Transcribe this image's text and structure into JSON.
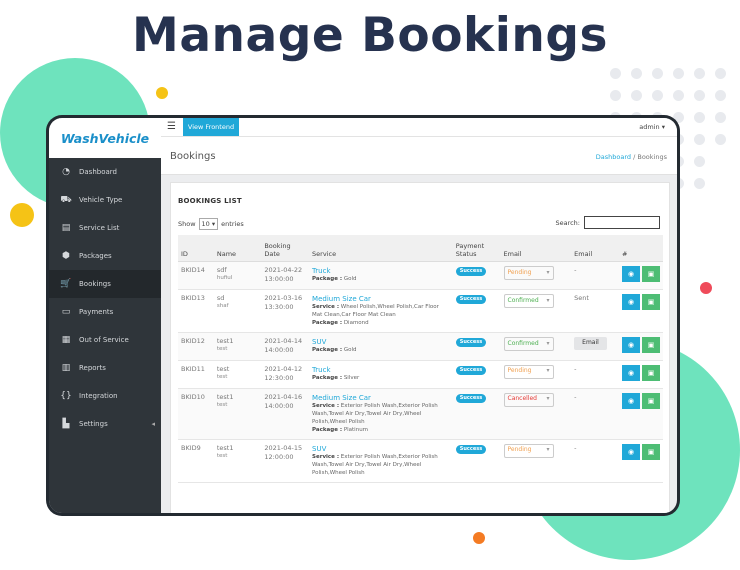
{
  "headline": "Manage Bookings",
  "brand": "WashVehicle",
  "topbar": {
    "view_frontend": "View Frontend",
    "admin": "admin ▾"
  },
  "sidebar": {
    "items": [
      {
        "label": "Dashboard",
        "icon": "dashboard-icon"
      },
      {
        "label": "Vehicle Type",
        "icon": "car-icon"
      },
      {
        "label": "Service List",
        "icon": "document-icon"
      },
      {
        "label": "Packages",
        "icon": "package-icon"
      },
      {
        "label": "Bookings",
        "icon": "cart-icon"
      },
      {
        "label": "Payments",
        "icon": "credit-card-icon"
      },
      {
        "label": "Out of Service",
        "icon": "calendar-icon"
      },
      {
        "label": "Reports",
        "icon": "report-icon"
      },
      {
        "label": "Integration",
        "icon": "braces-icon"
      },
      {
        "label": "Settings",
        "icon": "building-icon"
      }
    ]
  },
  "page": {
    "title": "Bookings",
    "breadcrumb_home": "Dashboard",
    "breadcrumb_sep": "/",
    "breadcrumb_current": "Bookings"
  },
  "list": {
    "title": "BOOKINGS LIST",
    "show_label": "Show",
    "show_value": "10",
    "entries_label": "entries",
    "search_label": "Search:"
  },
  "columns": {
    "id": "ID",
    "name": "Name",
    "date": "Booking Date",
    "service": "Service",
    "payment": "Payment Status",
    "email_status": "Email",
    "email": "Email",
    "actions": "#"
  },
  "rows": [
    {
      "id": "BKID14",
      "name": "sdf",
      "sub": "hufiul",
      "date": "2021-04-22",
      "time": "13:00:00",
      "service": "Truck",
      "service_line": "",
      "package_label": "Package :",
      "package": "Gold",
      "payment": "Success",
      "status": "Pending",
      "email": "-"
    },
    {
      "id": "BKID13",
      "name": "sd",
      "sub": "shaf",
      "date": "2021-03-16",
      "time": "13:30:00",
      "service": "Medium Size Car",
      "service_label": "Service :",
      "service_line": "Wheel Polish,Wheel Polish,Car Floor Mat Clean,Car Floor Mat Clean",
      "package_label": "Package :",
      "package": "Diamond",
      "payment": "Success",
      "status": "Confirmed",
      "email": "Sent"
    },
    {
      "id": "BKID12",
      "name": "test1",
      "sub": "test",
      "date": "2021-04-14",
      "time": "14:00:00",
      "service": "SUV",
      "service_line": "",
      "package_label": "Package :",
      "package": "Gold",
      "payment": "Success",
      "status": "Confirmed",
      "email": "Email"
    },
    {
      "id": "BKID11",
      "name": "test",
      "sub": "test",
      "date": "2021-04-12",
      "time": "12:30:00",
      "service": "Truck",
      "service_line": "",
      "package_label": "Package :",
      "package": "Silver",
      "payment": "Success",
      "status": "Pending",
      "email": "-"
    },
    {
      "id": "BKID10",
      "name": "test1",
      "sub": "test",
      "date": "2021-04-16",
      "time": "14:00:00",
      "service": "Medium Size Car",
      "service_label": "Service :",
      "service_line": "Exterior Polish Wash,Exterior Polish Wash,Towel Air Dry,Towel Air Dry,Wheel Polish,Wheel Polish",
      "package_label": "Package :",
      "package": "Platinum",
      "payment": "Success",
      "status": "Cancelled",
      "email": "-"
    },
    {
      "id": "BKID9",
      "name": "test1",
      "sub": "test",
      "date": "2021-04-15",
      "time": "12:00:00",
      "service": "SUV",
      "service_label": "Service :",
      "service_line": "Exterior Polish Wash,Exterior Polish Wash,Towel Air Dry,Towel Air Dry,Wheel Polish,Wheel Polish",
      "package_label": "",
      "package": "",
      "payment": "Success",
      "status": "Pending",
      "email": "-"
    }
  ],
  "colors": {
    "accent": "#20a8d8",
    "success": "#4dbd74",
    "sidebar": "#2f353a",
    "mint": "#6ee3bd",
    "headline": "#26324f"
  }
}
